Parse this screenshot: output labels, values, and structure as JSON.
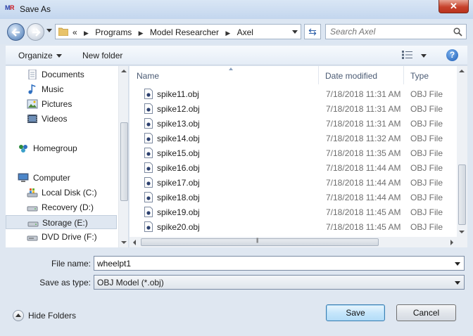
{
  "window": {
    "title": "Save As",
    "logo": "MR",
    "close_label": "✕"
  },
  "address": {
    "overflow": "«",
    "crumbs": [
      "Programs",
      "Model Researcher",
      "Axel"
    ],
    "search_placeholder": "Search Axel"
  },
  "toolbar": {
    "organize": "Organize",
    "new_folder": "New folder",
    "help": "?"
  },
  "nav": {
    "libraries": [
      {
        "label": "Documents",
        "icon": "documents-icon"
      },
      {
        "label": "Music",
        "icon": "music-icon"
      },
      {
        "label": "Pictures",
        "icon": "pictures-icon"
      },
      {
        "label": "Videos",
        "icon": "videos-icon"
      }
    ],
    "homegroup": "Homegroup",
    "computer": "Computer",
    "drives": [
      {
        "label": "Local Disk (C:)",
        "selected": false
      },
      {
        "label": "Recovery (D:)",
        "selected": false
      },
      {
        "label": "Storage (E:)",
        "selected": true
      },
      {
        "label": "DVD Drive (F:)",
        "selected": false
      }
    ]
  },
  "columns": {
    "name": "Name",
    "date": "Date modified",
    "type": "Type"
  },
  "files": [
    {
      "name": "spike11.obj",
      "date": "7/18/2018 11:31 AM",
      "type": "OBJ File"
    },
    {
      "name": "spike12.obj",
      "date": "7/18/2018 11:31 AM",
      "type": "OBJ File"
    },
    {
      "name": "spike13.obj",
      "date": "7/18/2018 11:31 AM",
      "type": "OBJ File"
    },
    {
      "name": "spike14.obj",
      "date": "7/18/2018 11:32 AM",
      "type": "OBJ File"
    },
    {
      "name": "spike15.obj",
      "date": "7/18/2018 11:35 AM",
      "type": "OBJ File"
    },
    {
      "name": "spike16.obj",
      "date": "7/18/2018 11:44 AM",
      "type": "OBJ File"
    },
    {
      "name": "spike17.obj",
      "date": "7/18/2018 11:44 AM",
      "type": "OBJ File"
    },
    {
      "name": "spike18.obj",
      "date": "7/18/2018 11:44 AM",
      "type": "OBJ File"
    },
    {
      "name": "spike19.obj",
      "date": "7/18/2018 11:45 AM",
      "type": "OBJ File"
    },
    {
      "name": "spike20.obj",
      "date": "7/18/2018 11:45 AM",
      "type": "OBJ File"
    }
  ],
  "form": {
    "file_name_label": "File name:",
    "file_name_value": "wheelpt1",
    "save_type_label": "Save as type:",
    "save_type_value": "OBJ Model (*.obj)"
  },
  "footer": {
    "hide_folders": "Hide Folders",
    "save": "Save",
    "cancel": "Cancel"
  }
}
